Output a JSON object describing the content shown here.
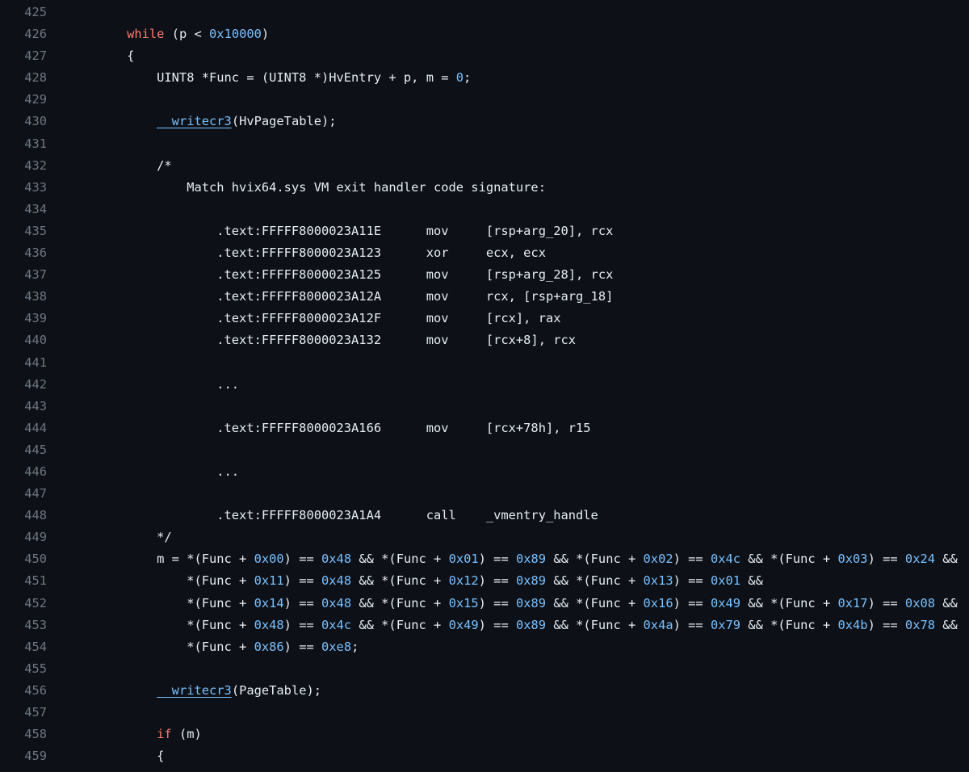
{
  "colors": {
    "background": "#0d1117",
    "line_number": "#6e7681",
    "text": "#e6edf3",
    "keyword": "#ff7b72",
    "number": "#79c0ff",
    "function": "#79c0ff"
  },
  "lines": [
    {
      "n": "425",
      "tokens": []
    },
    {
      "n": "426",
      "tokens": [
        [
          "t",
          "    "
        ],
        [
          "kw",
          "while"
        ],
        [
          "t",
          " (p < "
        ],
        [
          "num",
          "0x10000"
        ],
        [
          "t",
          ")"
        ]
      ]
    },
    {
      "n": "427",
      "tokens": [
        [
          "t",
          "    {"
        ]
      ]
    },
    {
      "n": "428",
      "tokens": [
        [
          "t",
          "        UINT8 *Func = (UINT8 *)HvEntry + p, m = "
        ],
        [
          "num",
          "0"
        ],
        [
          "t",
          ";"
        ]
      ]
    },
    {
      "n": "429",
      "tokens": []
    },
    {
      "n": "430",
      "tokens": [
        [
          "t",
          "        "
        ],
        [
          "fn",
          "__writecr3"
        ],
        [
          "t",
          "(HvPageTable);"
        ]
      ]
    },
    {
      "n": "431",
      "tokens": []
    },
    {
      "n": "432",
      "tokens": [
        [
          "t",
          "        /*"
        ]
      ]
    },
    {
      "n": "433",
      "tokens": [
        [
          "t",
          "            Match hvix64.sys VM exit handler code signature:"
        ]
      ]
    },
    {
      "n": "434",
      "tokens": []
    },
    {
      "n": "435",
      "tokens": [
        [
          "t",
          "                .text:FFFFF8000023A11E      mov     [rsp+arg_20], rcx"
        ]
      ]
    },
    {
      "n": "436",
      "tokens": [
        [
          "t",
          "                .text:FFFFF8000023A123      xor     ecx, ecx"
        ]
      ]
    },
    {
      "n": "437",
      "tokens": [
        [
          "t",
          "                .text:FFFFF8000023A125      mov     [rsp+arg_28], rcx"
        ]
      ]
    },
    {
      "n": "438",
      "tokens": [
        [
          "t",
          "                .text:FFFFF8000023A12A      mov     rcx, [rsp+arg_18]"
        ]
      ]
    },
    {
      "n": "439",
      "tokens": [
        [
          "t",
          "                .text:FFFFF8000023A12F      mov     [rcx], rax"
        ]
      ]
    },
    {
      "n": "440",
      "tokens": [
        [
          "t",
          "                .text:FFFFF8000023A132      mov     [rcx+8], rcx"
        ]
      ]
    },
    {
      "n": "441",
      "tokens": []
    },
    {
      "n": "442",
      "tokens": [
        [
          "t",
          "                ..."
        ]
      ]
    },
    {
      "n": "443",
      "tokens": []
    },
    {
      "n": "444",
      "tokens": [
        [
          "t",
          "                .text:FFFFF8000023A166      mov     [rcx+78h], r15"
        ]
      ]
    },
    {
      "n": "445",
      "tokens": []
    },
    {
      "n": "446",
      "tokens": [
        [
          "t",
          "                ..."
        ]
      ]
    },
    {
      "n": "447",
      "tokens": []
    },
    {
      "n": "448",
      "tokens": [
        [
          "t",
          "                .text:FFFFF8000023A1A4      call    _vmentry_handle"
        ]
      ]
    },
    {
      "n": "449",
      "tokens": [
        [
          "t",
          "        */"
        ]
      ]
    },
    {
      "n": "450",
      "tokens": [
        [
          "t",
          "        m = *(Func + "
        ],
        [
          "num",
          "0x00"
        ],
        [
          "t",
          ") == "
        ],
        [
          "num",
          "0x48"
        ],
        [
          "t",
          " && *(Func + "
        ],
        [
          "num",
          "0x01"
        ],
        [
          "t",
          ") == "
        ],
        [
          "num",
          "0x89"
        ],
        [
          "t",
          " && *(Func + "
        ],
        [
          "num",
          "0x02"
        ],
        [
          "t",
          ") == "
        ],
        [
          "num",
          "0x4c"
        ],
        [
          "t",
          " && *(Func + "
        ],
        [
          "num",
          "0x03"
        ],
        [
          "t",
          ") == "
        ],
        [
          "num",
          "0x24"
        ],
        [
          "t",
          " &&"
        ]
      ]
    },
    {
      "n": "451",
      "tokens": [
        [
          "t",
          "            *(Func + "
        ],
        [
          "num",
          "0x11"
        ],
        [
          "t",
          ") == "
        ],
        [
          "num",
          "0x48"
        ],
        [
          "t",
          " && *(Func + "
        ],
        [
          "num",
          "0x12"
        ],
        [
          "t",
          ") == "
        ],
        [
          "num",
          "0x89"
        ],
        [
          "t",
          " && *(Func + "
        ],
        [
          "num",
          "0x13"
        ],
        [
          "t",
          ") == "
        ],
        [
          "num",
          "0x01"
        ],
        [
          "t",
          " &&"
        ]
      ]
    },
    {
      "n": "452",
      "tokens": [
        [
          "t",
          "            *(Func + "
        ],
        [
          "num",
          "0x14"
        ],
        [
          "t",
          ") == "
        ],
        [
          "num",
          "0x48"
        ],
        [
          "t",
          " && *(Func + "
        ],
        [
          "num",
          "0x15"
        ],
        [
          "t",
          ") == "
        ],
        [
          "num",
          "0x89"
        ],
        [
          "t",
          " && *(Func + "
        ],
        [
          "num",
          "0x16"
        ],
        [
          "t",
          ") == "
        ],
        [
          "num",
          "0x49"
        ],
        [
          "t",
          " && *(Func + "
        ],
        [
          "num",
          "0x17"
        ],
        [
          "t",
          ") == "
        ],
        [
          "num",
          "0x08"
        ],
        [
          "t",
          " &&"
        ]
      ]
    },
    {
      "n": "453",
      "tokens": [
        [
          "t",
          "            *(Func + "
        ],
        [
          "num",
          "0x48"
        ],
        [
          "t",
          ") == "
        ],
        [
          "num",
          "0x4c"
        ],
        [
          "t",
          " && *(Func + "
        ],
        [
          "num",
          "0x49"
        ],
        [
          "t",
          ") == "
        ],
        [
          "num",
          "0x89"
        ],
        [
          "t",
          " && *(Func + "
        ],
        [
          "num",
          "0x4a"
        ],
        [
          "t",
          ") == "
        ],
        [
          "num",
          "0x79"
        ],
        [
          "t",
          " && *(Func + "
        ],
        [
          "num",
          "0x4b"
        ],
        [
          "t",
          ") == "
        ],
        [
          "num",
          "0x78"
        ],
        [
          "t",
          " &&"
        ]
      ]
    },
    {
      "n": "454",
      "tokens": [
        [
          "t",
          "            *(Func + "
        ],
        [
          "num",
          "0x86"
        ],
        [
          "t",
          ") == "
        ],
        [
          "num",
          "0xe8"
        ],
        [
          "t",
          ";"
        ]
      ]
    },
    {
      "n": "455",
      "tokens": []
    },
    {
      "n": "456",
      "tokens": [
        [
          "t",
          "        "
        ],
        [
          "fn",
          "__writecr3"
        ],
        [
          "t",
          "(PageTable);"
        ]
      ]
    },
    {
      "n": "457",
      "tokens": []
    },
    {
      "n": "458",
      "tokens": [
        [
          "t",
          "        "
        ],
        [
          "kw",
          "if"
        ],
        [
          "t",
          " (m)"
        ]
      ]
    },
    {
      "n": "459",
      "tokens": [
        [
          "t",
          "        {"
        ]
      ]
    }
  ]
}
